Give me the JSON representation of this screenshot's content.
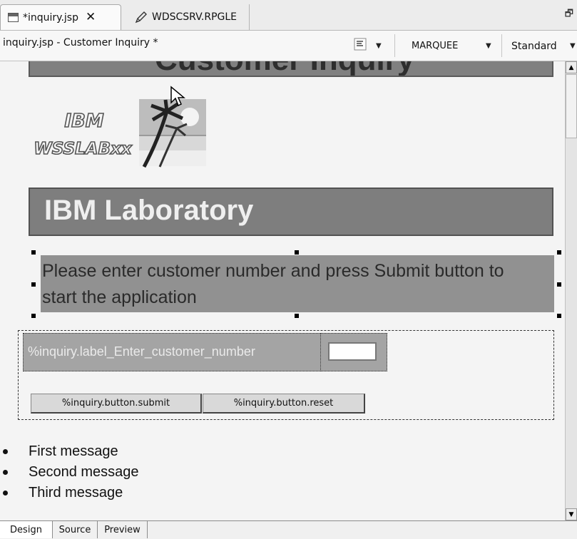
{
  "tabs": [
    {
      "label": "*inquiry.jsp",
      "icon": "jsp-file-icon",
      "active": true
    },
    {
      "label": "WDSCSRV.RPGLE",
      "icon": "pencil-icon",
      "active": false
    }
  ],
  "editor": {
    "title": "inquiry.jsp - Customer Inquiry *",
    "selection_mode": "MARQUEE",
    "layout_mode": "Standard"
  },
  "page": {
    "top_heading": "Customer Inquiry",
    "logo_text": [
      "IBM",
      "WSSLABxx"
    ],
    "lab_heading": "IBM Laboratory",
    "instruction": "Please enter customer number and press Submit button to start the application",
    "form": {
      "label": "%inquiry.label_Enter_customer_number",
      "input_value": "",
      "submit_label": "%inquiry.button.submit",
      "reset_label": "%inquiry.button.reset"
    },
    "messages": [
      "First message",
      "Second message",
      "Third message"
    ]
  },
  "bottom_tabs": [
    {
      "label": "Design",
      "active": true
    },
    {
      "label": "Source",
      "active": false
    },
    {
      "label": "Preview",
      "active": false
    }
  ]
}
